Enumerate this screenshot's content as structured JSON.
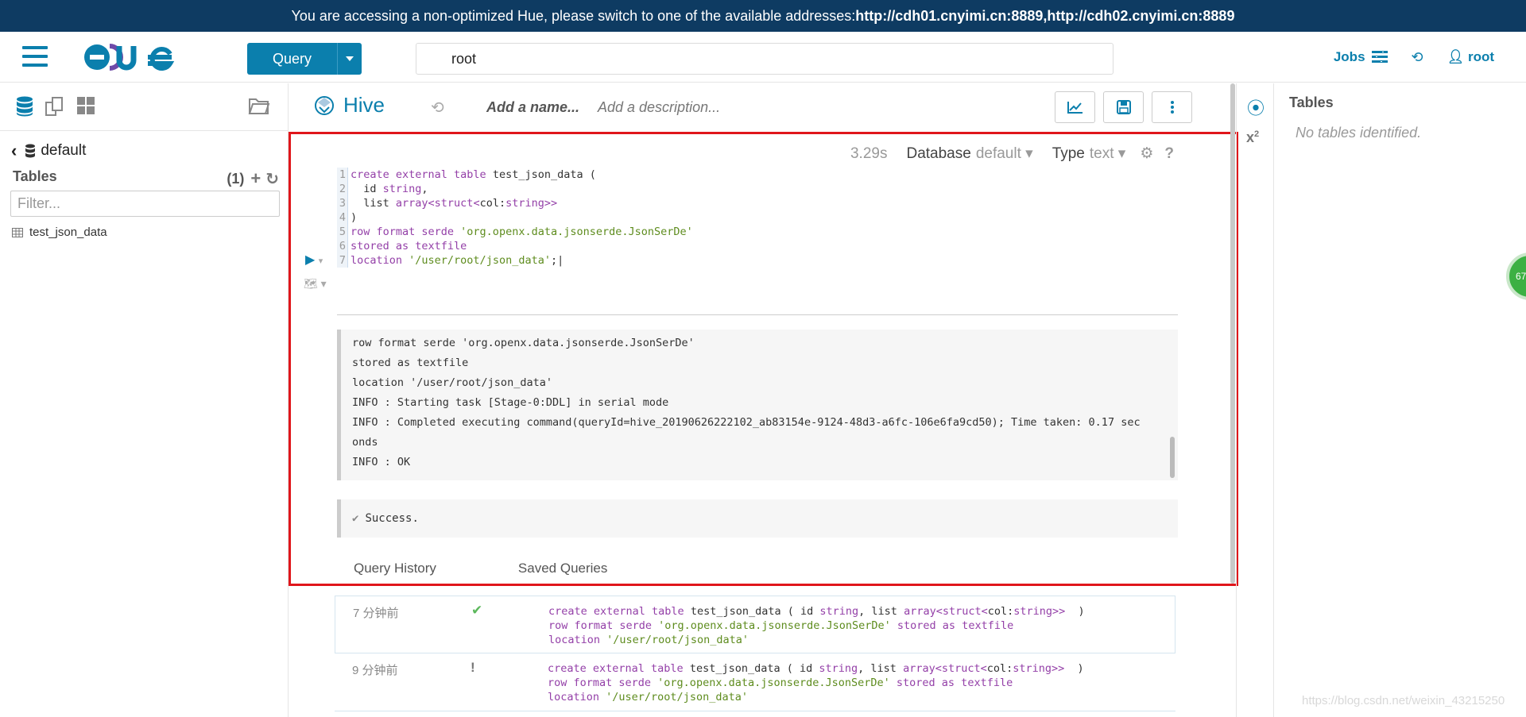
{
  "banner": {
    "prefix": "You are accessing a non-optimized Hue, please switch to one of the available addresses: ",
    "link1": "http://cdh01.cnyimi.cn:8889",
    "separator": ", ",
    "link2": "http://cdh02.cnyimi.cn:8889"
  },
  "navbar": {
    "query_label": "Query",
    "search_value": "root",
    "jobs_label": "Jobs",
    "user_label": "root"
  },
  "left_panel": {
    "database": "default",
    "tables_label": "Tables",
    "tables_count": "(1)",
    "filter_placeholder": "Filter...",
    "tables": [
      "test_json_data"
    ]
  },
  "editor": {
    "engine": "Hive",
    "name_placeholder": "Add a name...",
    "description_placeholder": "Add a description...",
    "exec_time": "3.29s",
    "database_label": "Database",
    "database_value": "default",
    "type_label": "Type",
    "type_value": "text",
    "code_lines": [
      "create external table test_json_data (",
      "  id string,",
      "  list array<struct<col:string>>",
      ")",
      "row format serde 'org.openx.data.jsonserde.JsonSerDe'",
      "stored as textfile",
      "location '/user/root/json_data';"
    ]
  },
  "log": {
    "lines": [
      "row format serde 'org.openx.data.jsonserde.JsonSerDe'",
      "stored as textfile",
      "location '/user/root/json_data'",
      "INFO  : Starting task [Stage-0:DDL] in serial mode",
      "INFO  : Completed executing command(queryId=hive_20190626222102_ab83154e-9124-48d3-a6fc-106e6fa9cd50); Time taken: 0.17 sec",
      "onds",
      "INFO  : OK"
    ]
  },
  "result": {
    "success": "Success."
  },
  "tabs": {
    "history": "Query History",
    "saved": "Saved Queries"
  },
  "history": [
    {
      "time": "7 分钟前",
      "status": "success"
    },
    {
      "time": "9 分钟前",
      "status": "warning"
    }
  ],
  "right_panel": {
    "title": "Tables",
    "empty": "No tables identified."
  },
  "badge": {
    "value": "67"
  },
  "watermark": "https://blog.csdn.net/weixin_43215250",
  "colors": {
    "brand": "#0b7fad",
    "banner": "#0e3b62",
    "highlight": "#e0161b",
    "success": "#3cb043"
  }
}
